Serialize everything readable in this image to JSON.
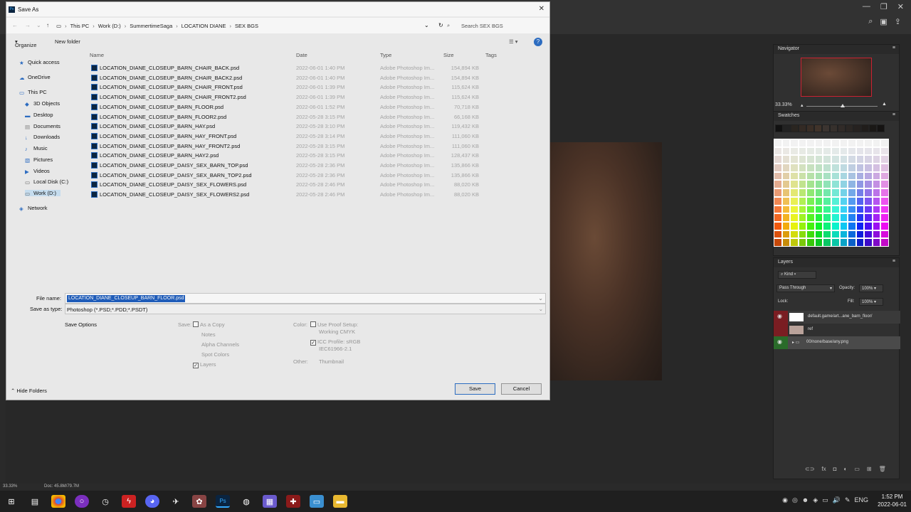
{
  "dialog": {
    "title": "Save As",
    "breadcrumbs": [
      "This PC",
      "Work (D:)",
      "SummertimeSaga",
      "LOCATION DIANE",
      "SEX BGS"
    ],
    "search_placeholder": "Search SEX BGS",
    "organize": "Organize",
    "new_folder": "New folder",
    "tree": [
      "Quick access",
      "OneDrive",
      "This PC",
      "3D Objects",
      "Desktop",
      "Documents",
      "Downloads",
      "Music",
      "Pictures",
      "Videos",
      "Local Disk (C:)",
      "Work (D:)",
      "Network"
    ],
    "columns": {
      "name": "Name",
      "date": "Date",
      "type": "Type",
      "size": "Size",
      "tags": "Tags"
    },
    "files": [
      {
        "name": "LOCATION_DIANE_CLOSEUP_BARN_CHAIR_BACK.psd",
        "date": "2022-06-01 1:40 PM",
        "type": "Adobe Photoshop Im...",
        "size": "154,894 KB"
      },
      {
        "name": "LOCATION_DIANE_CLOSEUP_BARN_CHAIR_BACK2.psd",
        "date": "2022-06-01 1:40 PM",
        "type": "Adobe Photoshop Im...",
        "size": "154,894 KB"
      },
      {
        "name": "LOCATION_DIANE_CLOSEUP_BARN_CHAIR_FRONT.psd",
        "date": "2022-06-01 1:39 PM",
        "type": "Adobe Photoshop Im...",
        "size": "115,624 KB"
      },
      {
        "name": "LOCATION_DIANE_CLOSEUP_BARN_CHAIR_FRONT2.psd",
        "date": "2022-06-01 1:39 PM",
        "type": "Adobe Photoshop Im...",
        "size": "115,624 KB"
      },
      {
        "name": "LOCATION_DIANE_CLOSEUP_BARN_FLOOR.psd",
        "date": "2022-06-01 1:52 PM",
        "type": "Adobe Photoshop Im...",
        "size": "70,718 KB"
      },
      {
        "name": "LOCATION_DIANE_CLOSEUP_BARN_FLOOR2.psd",
        "date": "2022-05-28 3:15 PM",
        "type": "Adobe Photoshop Im...",
        "size": "66,168 KB"
      },
      {
        "name": "LOCATION_DIANE_CLOSEUP_BARN_HAY.psd",
        "date": "2022-05-28 3:10 PM",
        "type": "Adobe Photoshop Im...",
        "size": "119,432 KB"
      },
      {
        "name": "LOCATION_DIANE_CLOSEUP_BARN_HAY_FRONT.psd",
        "date": "2022-05-28 3:14 PM",
        "type": "Adobe Photoshop Im...",
        "size": "111,060 KB"
      },
      {
        "name": "LOCATION_DIANE_CLOSEUP_BARN_HAY_FRONT2.psd",
        "date": "2022-05-28 3:15 PM",
        "type": "Adobe Photoshop Im...",
        "size": "111,060 KB"
      },
      {
        "name": "LOCATION_DIANE_CLOSEUP_BARN_HAY2.psd",
        "date": "2022-05-28 3:15 PM",
        "type": "Adobe Photoshop Im...",
        "size": "128,437 KB"
      },
      {
        "name": "LOCATION_DIANE_CLOSEUP_DAISY_SEX_BARN_TOP.psd",
        "date": "2022-05-28 2:36 PM",
        "type": "Adobe Photoshop Im...",
        "size": "135,866 KB"
      },
      {
        "name": "LOCATION_DIANE_CLOSEUP_DAISY_SEX_BARN_TOP2.psd",
        "date": "2022-05-28 2:36 PM",
        "type": "Adobe Photoshop Im...",
        "size": "135,866 KB"
      },
      {
        "name": "LOCATION_DIANE_CLOSEUP_DAISY_SEX_FLOWERS.psd",
        "date": "2022-05-28 2:46 PM",
        "type": "Adobe Photoshop Im...",
        "size": "88,020 KB"
      },
      {
        "name": "LOCATION_DIANE_CLOSEUP_DAISY_SEX_FLOWERS2.psd",
        "date": "2022-05-28 2:46 PM",
        "type": "Adobe Photoshop Im...",
        "size": "88,020 KB"
      }
    ],
    "file_name_label": "File name:",
    "file_name_value": "LOCATION_DIANE_CLOSEUP_BARN_FLOOR.psd",
    "save_type_label": "Save as type:",
    "save_type_value": "Photoshop (*.PSD;*.PDD;*.PSDT)",
    "save_options": "Save Options",
    "save_label": "Save:",
    "opt_as_copy": "As a Copy",
    "opt_notes": "Notes",
    "opt_alpha": "Alpha Channels",
    "opt_spot": "Spot Colors",
    "opt_layers": "Layers",
    "color_label": "Color:",
    "opt_proof": "Use Proof Setup:",
    "opt_proof_sub": "Working CMYK",
    "opt_icc": "ICC Profile: sRGB",
    "opt_icc_sub": "IEC61966-2.1",
    "other_label": "Other:",
    "opt_thumb": "Thumbnail",
    "save_button": "Save",
    "cancel_button": "Cancel",
    "hide_folders": "Hide Folders"
  },
  "photoshop": {
    "navigator_title": "Navigator",
    "nav_zoom": "33.33%",
    "swatches_title": "Swatches",
    "layers_title": "Layers",
    "kind": "Kind",
    "blend_mode": "Pass Through",
    "opacity_label": "Opacity:",
    "opacity_value": "100%",
    "lock_label": "Lock:",
    "fill_label": "Fill:",
    "fill_value": "100%",
    "layers": [
      "default.game/art...ane_barn_floor/",
      "ref",
      "00/none/base/any.png"
    ],
    "status_zoom": "33.33%",
    "status_doc": "Doc: 45.8M/79.7M"
  },
  "taskbar": {
    "lang": "ENG",
    "time": "1:52 PM",
    "date": "2022-06-01"
  }
}
